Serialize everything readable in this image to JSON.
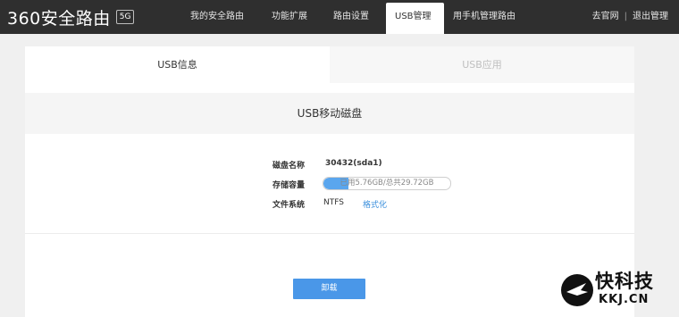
{
  "brand": {
    "name": "360安全路由",
    "badge": "5G"
  },
  "nav": {
    "items": [
      {
        "label": "我的安全路由",
        "active": false
      },
      {
        "label": "功能扩展",
        "active": false
      },
      {
        "label": "路由设置",
        "active": false
      },
      {
        "label": "USB管理",
        "active": true
      },
      {
        "label": "用手机管理路由",
        "active": false
      }
    ]
  },
  "top_right": {
    "official_site": "去官网",
    "separator": "|",
    "logout": "退出管理"
  },
  "tabs": [
    {
      "label": "USB信息",
      "active": true
    },
    {
      "label": "USB应用",
      "active": false
    }
  ],
  "section": {
    "title": "USB移动磁盘"
  },
  "disk": {
    "name_label": "磁盘名称",
    "name_value": "30432(sda1)",
    "capacity_label": "存储容量",
    "usage_text": "已用5.76GB/总共29.72GB",
    "usage_fraction": 0.194,
    "fs_label": "文件系统",
    "fs_value": "NTFS",
    "format_link": "格式化"
  },
  "actions": {
    "unmount": "卸载"
  },
  "watermark": {
    "title": "快科技",
    "sub": "KKJ.CN"
  },
  "colors": {
    "topbar": "#2f2f2f",
    "accent": "#4a97e8",
    "link": "#3b8fdc"
  }
}
